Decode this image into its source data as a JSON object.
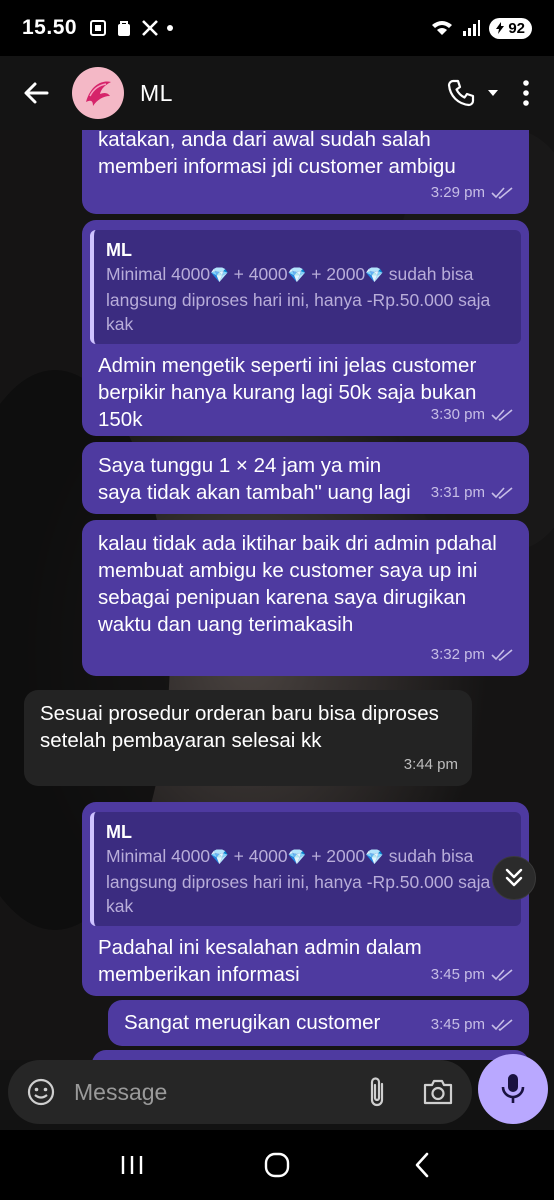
{
  "status_bar": {
    "time": "15.50",
    "battery": "92"
  },
  "header": {
    "contact_name": "ML"
  },
  "messages": [
    {
      "text": "katakan, anda dari awal sudah salah memberi informasi jdi customer ambigu",
      "time": "3:29 pm"
    },
    {
      "quote_author": "ML",
      "quote_text": {
        "a": "Minimal 4000",
        "b": " + 4000",
        "c": " + 2000",
        "d": " sudah bisa langsung diproses hari ini, hanya -Rp.50.000 saja kak"
      },
      "text": "Admin mengetik seperti ini jelas customer berpikir hanya kurang lagi 50k saja bukan 150k",
      "time": "3:30 pm"
    },
    {
      "text": "Saya tunggu 1 × 24 jam ya min saya tidak akan tambah\" uang lagi",
      "time": "3:31 pm"
    },
    {
      "text": "kalau tidak ada iktihar baik dri admin pdahal membuat ambigu ke customer saya up ini sebagai penipuan karena saya dirugikan waktu dan uang terimakasih",
      "time": "3:32 pm"
    },
    {
      "text": "Sesuai prosedur orderan baru bisa diproses setelah pembayaran selesai kk",
      "time": "3:44 pm"
    },
    {
      "quote_author": "ML",
      "quote_text": {
        "a": "Minimal 4000",
        "b": " + 4000",
        "c": " + 2000",
        "d": " sudah bisa langsung diproses hari ini, hanya -Rp.50.000 saja kak"
      },
      "text": "Padahal ini kesalahan admin dalam memberikan informasi",
      "time": "3:45 pm"
    },
    {
      "text": "Sangat merugikan customer",
      "time": "3:45 pm"
    }
  ],
  "composer": {
    "placeholder": "Message"
  },
  "icons": {
    "back": "arrow-left-icon",
    "call": "phone-icon",
    "menu": "more-vert-icon",
    "emoji": "sticker-icon",
    "attach": "paperclip-icon",
    "camera": "camera-icon",
    "mic": "mic-icon",
    "gem": "diamond-icon"
  },
  "colors": {
    "outgoing_bubble": "#4e3aa0",
    "incoming_bubble": "#232323",
    "mic_button": "#b9a8ff"
  }
}
